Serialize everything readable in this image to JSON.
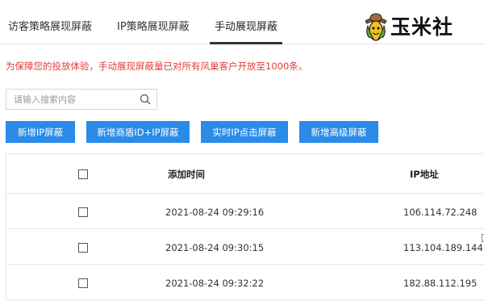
{
  "tabs": [
    {
      "label": "访客策略展现屏蔽",
      "active": false
    },
    {
      "label": "IP策略展现屏蔽",
      "active": false
    },
    {
      "label": "手动展现屏蔽",
      "active": true
    }
  ],
  "logo": {
    "text": "玉米社",
    "icon": "corn-mascot-icon"
  },
  "notice": "为保障您的投放体验，手动展现屏蔽量已对所有凤巢客户开放至1000条。",
  "search": {
    "placeholder": "请输入搜索内容",
    "value": "",
    "icon": "search-icon"
  },
  "buttons": [
    {
      "label": "新增IP屏蔽"
    },
    {
      "label": "新增商盾ID+IP屏蔽"
    },
    {
      "label": "实时IP点击屏蔽"
    },
    {
      "label": "新增高级屏蔽"
    }
  ],
  "table": {
    "headers": {
      "added_time": "添加时间",
      "ip": "IP地址"
    },
    "rows": [
      {
        "time": "2021-08-24 09:29:16",
        "ip": "106.114.72.248",
        "checked": false
      },
      {
        "time": "2021-08-24 09:30:15",
        "ip": "113.104.189.144",
        "checked": false
      },
      {
        "time": "2021-08-24 09:32:22",
        "ip": "182.88.112.195",
        "checked": false
      }
    ]
  },
  "colors": {
    "accent": "#2a8be8",
    "notice": "#e23c3c",
    "border": "#e6e6e6"
  }
}
